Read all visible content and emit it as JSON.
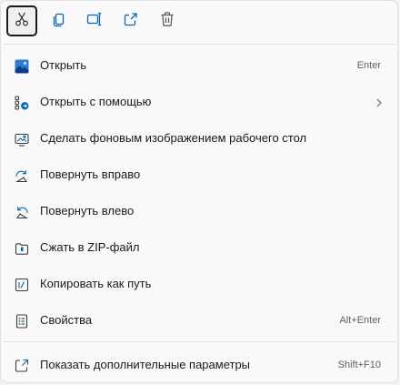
{
  "toolbar": {
    "buttons": [
      {
        "icon": "cut-icon"
      },
      {
        "icon": "copy-icon"
      },
      {
        "icon": "rename-icon"
      },
      {
        "icon": "share-icon"
      },
      {
        "icon": "delete-icon"
      }
    ]
  },
  "menu": {
    "items": [
      {
        "label": "Открыть",
        "shortcut": "Enter",
        "icon": "photos-app-icon"
      },
      {
        "label": "Открыть с помощью",
        "icon": "open-with-icon"
      },
      {
        "label": "Сделать фоновым изображением рабочего стола",
        "icon": "set-wallpaper-icon"
      },
      {
        "label": "Повернуть вправо",
        "icon": "rotate-right-icon"
      },
      {
        "label": "Повернуть влево",
        "icon": "rotate-left-icon"
      },
      {
        "label": "Сжать в ZIP-файл",
        "icon": "zip-icon"
      },
      {
        "label": "Копировать как путь",
        "icon": "copy-path-icon"
      },
      {
        "label": "Свойства",
        "shortcut": "Alt+Enter",
        "icon": "properties-icon"
      },
      {
        "label": "Показать дополнительные параметры",
        "shortcut": "Shift+F10",
        "icon": "more-options-icon"
      }
    ]
  },
  "colors": {
    "accent": "#0067c0",
    "icon": "#3c3c3c",
    "background": "#f9f9f9"
  }
}
